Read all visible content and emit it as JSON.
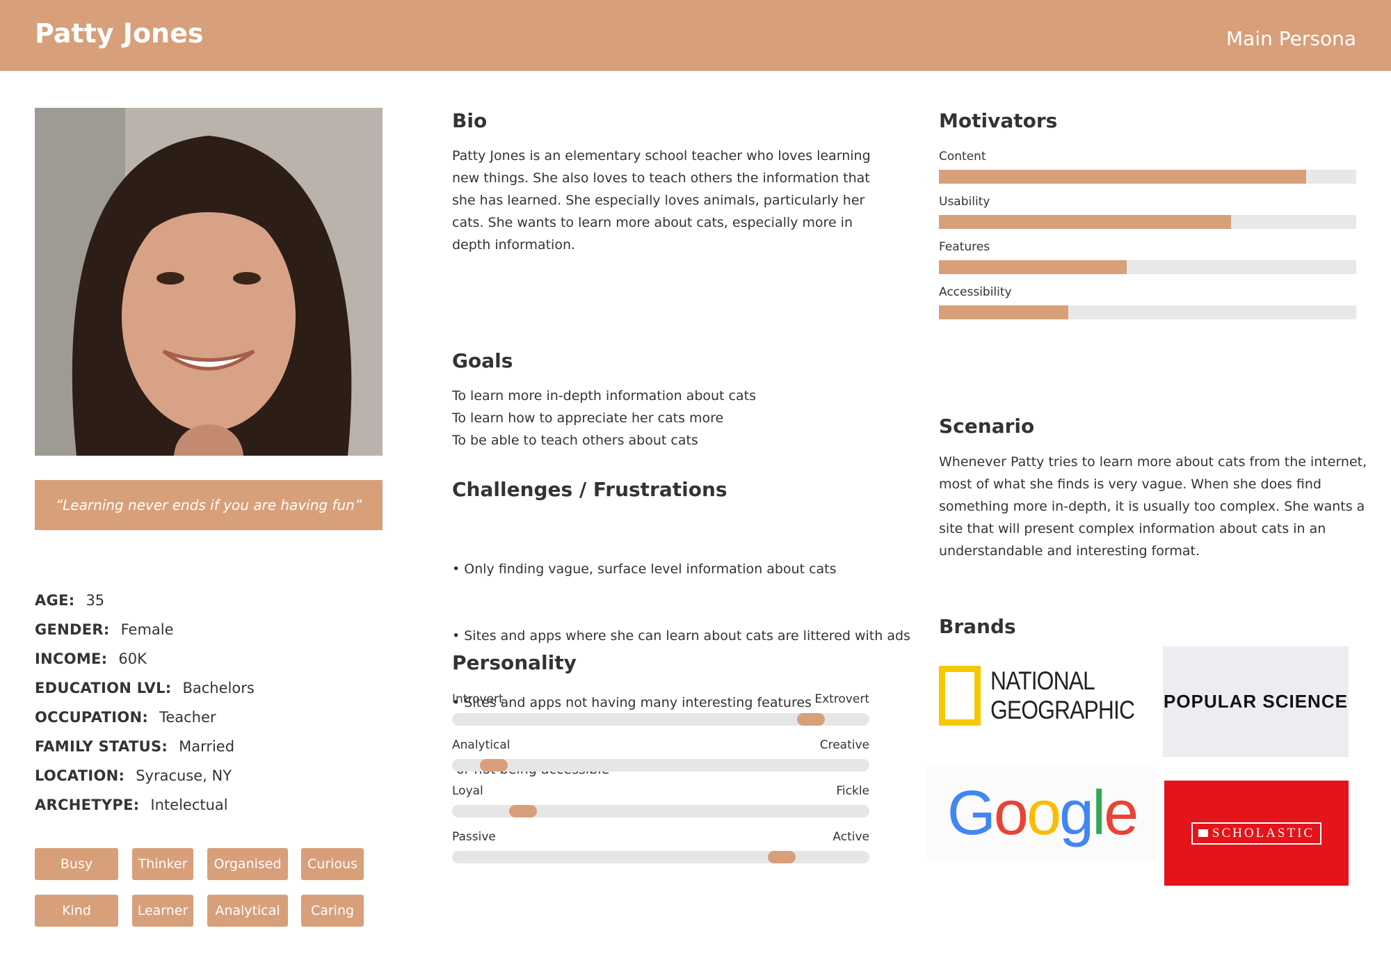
{
  "header": {
    "title": "Patty Jones",
    "subtitle": "Main Persona"
  },
  "quote": "“Learning never ends if you are having fun”",
  "demographics": [
    {
      "label": "AGE:",
      "value": "35"
    },
    {
      "label": "GENDER:",
      "value": "Female"
    },
    {
      "label": "INCOME:",
      "value": "60K"
    },
    {
      "label": "EDUCATION LVL:",
      "value": "Bachelors"
    },
    {
      "label": "OCCUPATION:",
      "value": "Teacher"
    },
    {
      "label": "FAMILY STATUS:",
      "value": "Married"
    },
    {
      "label": "LOCATION:",
      "value": "Syracuse, NY"
    },
    {
      "label": "ARCHETYPE:",
      "value": "Intelectual"
    }
  ],
  "tags": [
    "Busy",
    "Thinker",
    "Organised",
    "Curious",
    "Kind",
    "Learner",
    "Analytical",
    "Caring"
  ],
  "bio": {
    "title": "Bio",
    "lines": [
      "Patty Jones is an elementary school teacher who loves learning",
      "new things. She also loves to teach others the information that",
      "she has learned. She especially loves animals, particularly her",
      "cats. She wants to learn more about cats, especially more in",
      "depth information."
    ]
  },
  "goals": {
    "title": "Goals",
    "items": [
      "To learn more in-depth information about cats",
      "To learn how to appreciate her cats more",
      "To be able to teach others about cats"
    ]
  },
  "challenges": {
    "title": "Challenges / Frustrations",
    "lines": [
      "• Only finding vague, surface level information about cats",
      "• Sites and apps where she can learn about cats are littered with ads",
      "• Sites and apps not having many interesting features",
      " or not being accessible"
    ]
  },
  "personality": {
    "title": "Personality",
    "traits": [
      {
        "left": "Introvert",
        "right": "Extrovert",
        "value": 0.86
      },
      {
        "left": "Analytical",
        "right": "Creative",
        "value": 0.1
      },
      {
        "left": "Loyal",
        "right": "Fickle",
        "value": 0.17
      },
      {
        "left": "Passive",
        "right": "Active",
        "value": 0.79
      }
    ]
  },
  "motivators": {
    "title": "Motivators",
    "items": [
      {
        "label": "Content",
        "value": 0.88
      },
      {
        "label": "Usability",
        "value": 0.7
      },
      {
        "label": "Features",
        "value": 0.45
      },
      {
        "label": "Accessibility",
        "value": 0.31
      }
    ]
  },
  "scenario": {
    "title": "Scenario",
    "lines": [
      "Whenever Patty tries to learn more about cats from the internet,",
      "most of what she finds is very vague. When she does find",
      "something more in-depth, it is usually too complex. She wants a",
      "site that will present complex information about cats in an",
      "understandable and interesting format."
    ]
  },
  "brands": {
    "title": "Brands",
    "natgeo_line1": "NATIONAL",
    "natgeo_line2": "GEOGRAPHIC",
    "popsci": "POPULAR SCIENCE",
    "google": [
      "G",
      "o",
      "o",
      "g",
      "l",
      "e"
    ],
    "scholastic": "SCHOLASTIC"
  },
  "colors": {
    "accent": "#d79f7a",
    "track": "#e8e8e8",
    "natgeo_yellow": "#f6c800",
    "scholastic_red": "#e5131a",
    "google_blue": "#4285f4",
    "google_red": "#ea4335",
    "google_yellow": "#fbbc05",
    "google_green": "#34a853"
  }
}
